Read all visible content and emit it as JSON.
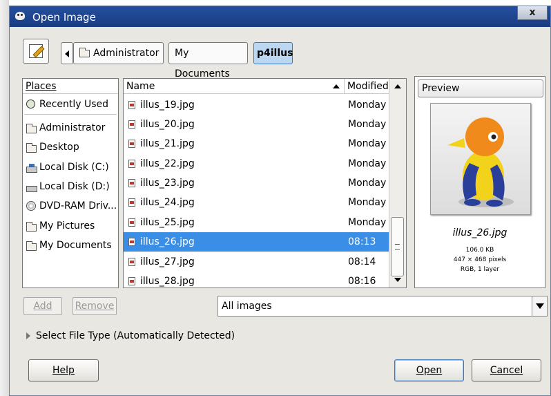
{
  "window": {
    "title": "Open Image",
    "close_label": "x"
  },
  "path_bar": {
    "crumbs": [
      "Administrator",
      "My Documents",
      "p4illus"
    ]
  },
  "places": {
    "header": "Places",
    "items": [
      {
        "label": "Recently Used",
        "icon": "recently-used-icon"
      },
      {
        "label": "Administrator",
        "icon": "folder-icon"
      },
      {
        "label": "Desktop",
        "icon": "folder-icon"
      },
      {
        "label": "Local Disk (C:)",
        "icon": "disk-icon"
      },
      {
        "label": "Local Disk (D:)",
        "icon": "disk-icon"
      },
      {
        "label": "DVD-RAM Driv...",
        "icon": "dvd-icon"
      },
      {
        "label": "My Pictures",
        "icon": "folder-icon"
      },
      {
        "label": "My Documents",
        "icon": "folder-icon"
      }
    ],
    "add_label": "Add",
    "remove_label": "Remove"
  },
  "files": {
    "col_name": "Name",
    "col_modified": "Modified",
    "rows": [
      {
        "name": "illus_19.jpg",
        "modified": "Monday"
      },
      {
        "name": "illus_20.jpg",
        "modified": "Monday"
      },
      {
        "name": "illus_21.jpg",
        "modified": "Monday"
      },
      {
        "name": "illus_22.jpg",
        "modified": "Monday"
      },
      {
        "name": "illus_23.jpg",
        "modified": "Monday"
      },
      {
        "name": "illus_24.jpg",
        "modified": "Monday"
      },
      {
        "name": "illus_25.jpg",
        "modified": "Monday"
      },
      {
        "name": "illus_26.jpg",
        "modified": "08:13",
        "selected": true
      },
      {
        "name": "illus_27.jpg",
        "modified": "08:14"
      },
      {
        "name": "illus_28.jpg",
        "modified": "08:16"
      }
    ]
  },
  "preview": {
    "header": "Preview",
    "filename": "illus_26.jpg",
    "size": "106.0 KB",
    "dimensions": "447 × 468 pixels",
    "mode": "RGB, 1 layer"
  },
  "filter": {
    "value": "All images"
  },
  "file_type_expander": "Select File Type (Automatically Detected)",
  "buttons": {
    "help": "Help",
    "open": "Open",
    "cancel": "Cancel"
  },
  "colors": {
    "selection": "#3a8ee6",
    "titlebar": "#254f9e",
    "dialog_bg": "#e9e7e2"
  }
}
